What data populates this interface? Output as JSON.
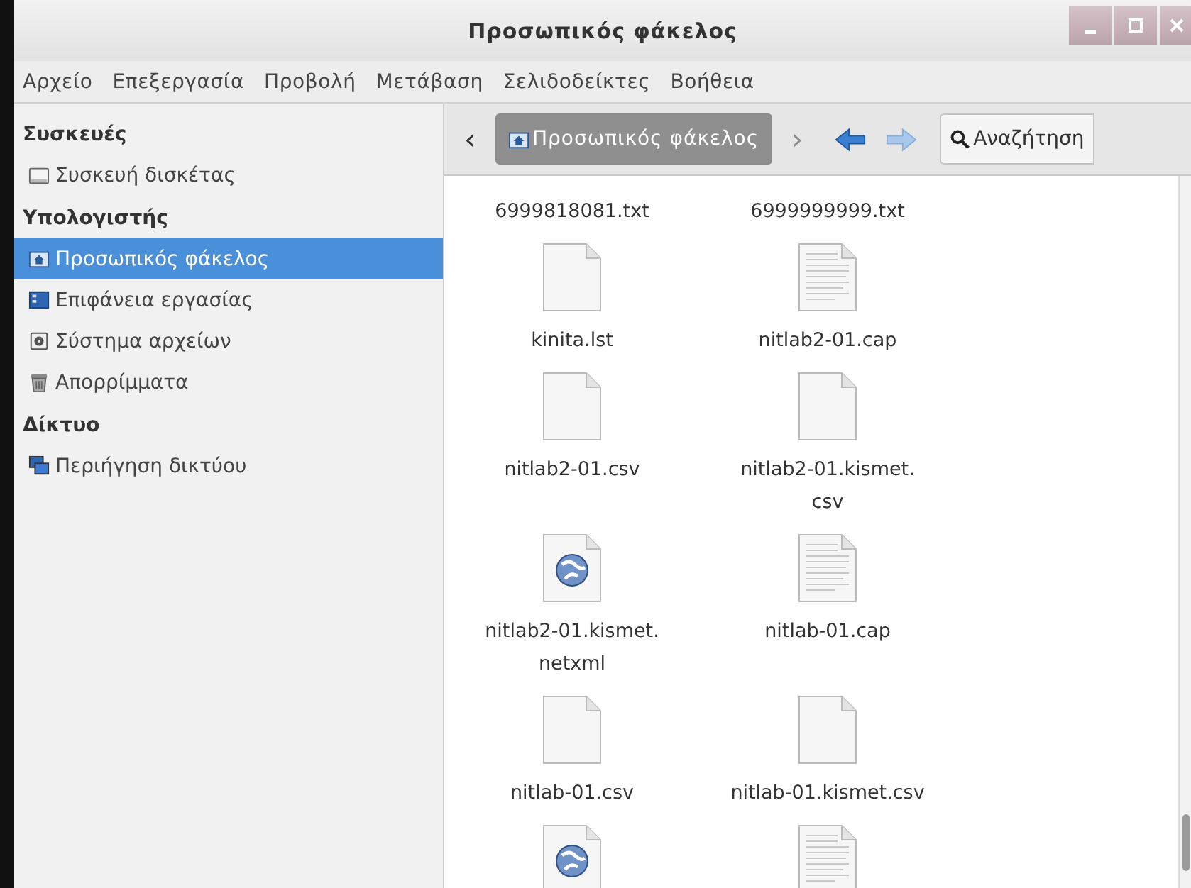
{
  "window": {
    "title": "Προσωπικός φάκελος"
  },
  "menu": [
    "Αρχείο",
    "Επεξεργασία",
    "Προβολή",
    "Μετάβαση",
    "Σελιδοδείκτες",
    "Βοήθεια"
  ],
  "sidebar": {
    "sections": [
      {
        "heading": "Συσκευές",
        "items": [
          {
            "label": "Συσκευή δισκέτας",
            "kind": "drive",
            "selected": false
          }
        ]
      },
      {
        "heading": "Υπολογιστής",
        "items": [
          {
            "label": "Προσωπικός φάκελος",
            "kind": "home",
            "selected": true
          },
          {
            "label": "Επιφάνεια εργασίας",
            "kind": "desktop",
            "selected": false
          },
          {
            "label": "Σύστημα αρχείων",
            "kind": "filesystem",
            "selected": false
          },
          {
            "label": "Απορρίμματα",
            "kind": "trash",
            "selected": false
          }
        ]
      },
      {
        "heading": "Δίκτυο",
        "items": [
          {
            "label": "Περιήγηση δικτύου",
            "kind": "network",
            "selected": false
          }
        ]
      }
    ]
  },
  "toolbar": {
    "back_crumb": "‹",
    "path": "Προσωπικός φάκελος",
    "forward_crumb": "›",
    "search": "Αναζήτηση"
  },
  "files": [
    {
      "name": "6999818081.txt",
      "kind": "label"
    },
    {
      "name": "6999999999.txt",
      "kind": "label"
    },
    {
      "name": "kinita.lst",
      "kind": "blank"
    },
    {
      "name": "nitlab2-01.cap",
      "kind": "text"
    },
    {
      "name": "nitlab2-01.csv",
      "kind": "blank"
    },
    {
      "name": "nitlab2-01.kismet.\ncsv",
      "kind": "blank"
    },
    {
      "name": "nitlab2-01.kismet.\nnetxml",
      "kind": "web"
    },
    {
      "name": "nitlab-01.cap",
      "kind": "text"
    },
    {
      "name": "nitlab-01.csv",
      "kind": "blank"
    },
    {
      "name": "nitlab-01.kismet.csv",
      "kind": "blank"
    },
    {
      "kind": "web"
    },
    {
      "kind": "text"
    }
  ]
}
